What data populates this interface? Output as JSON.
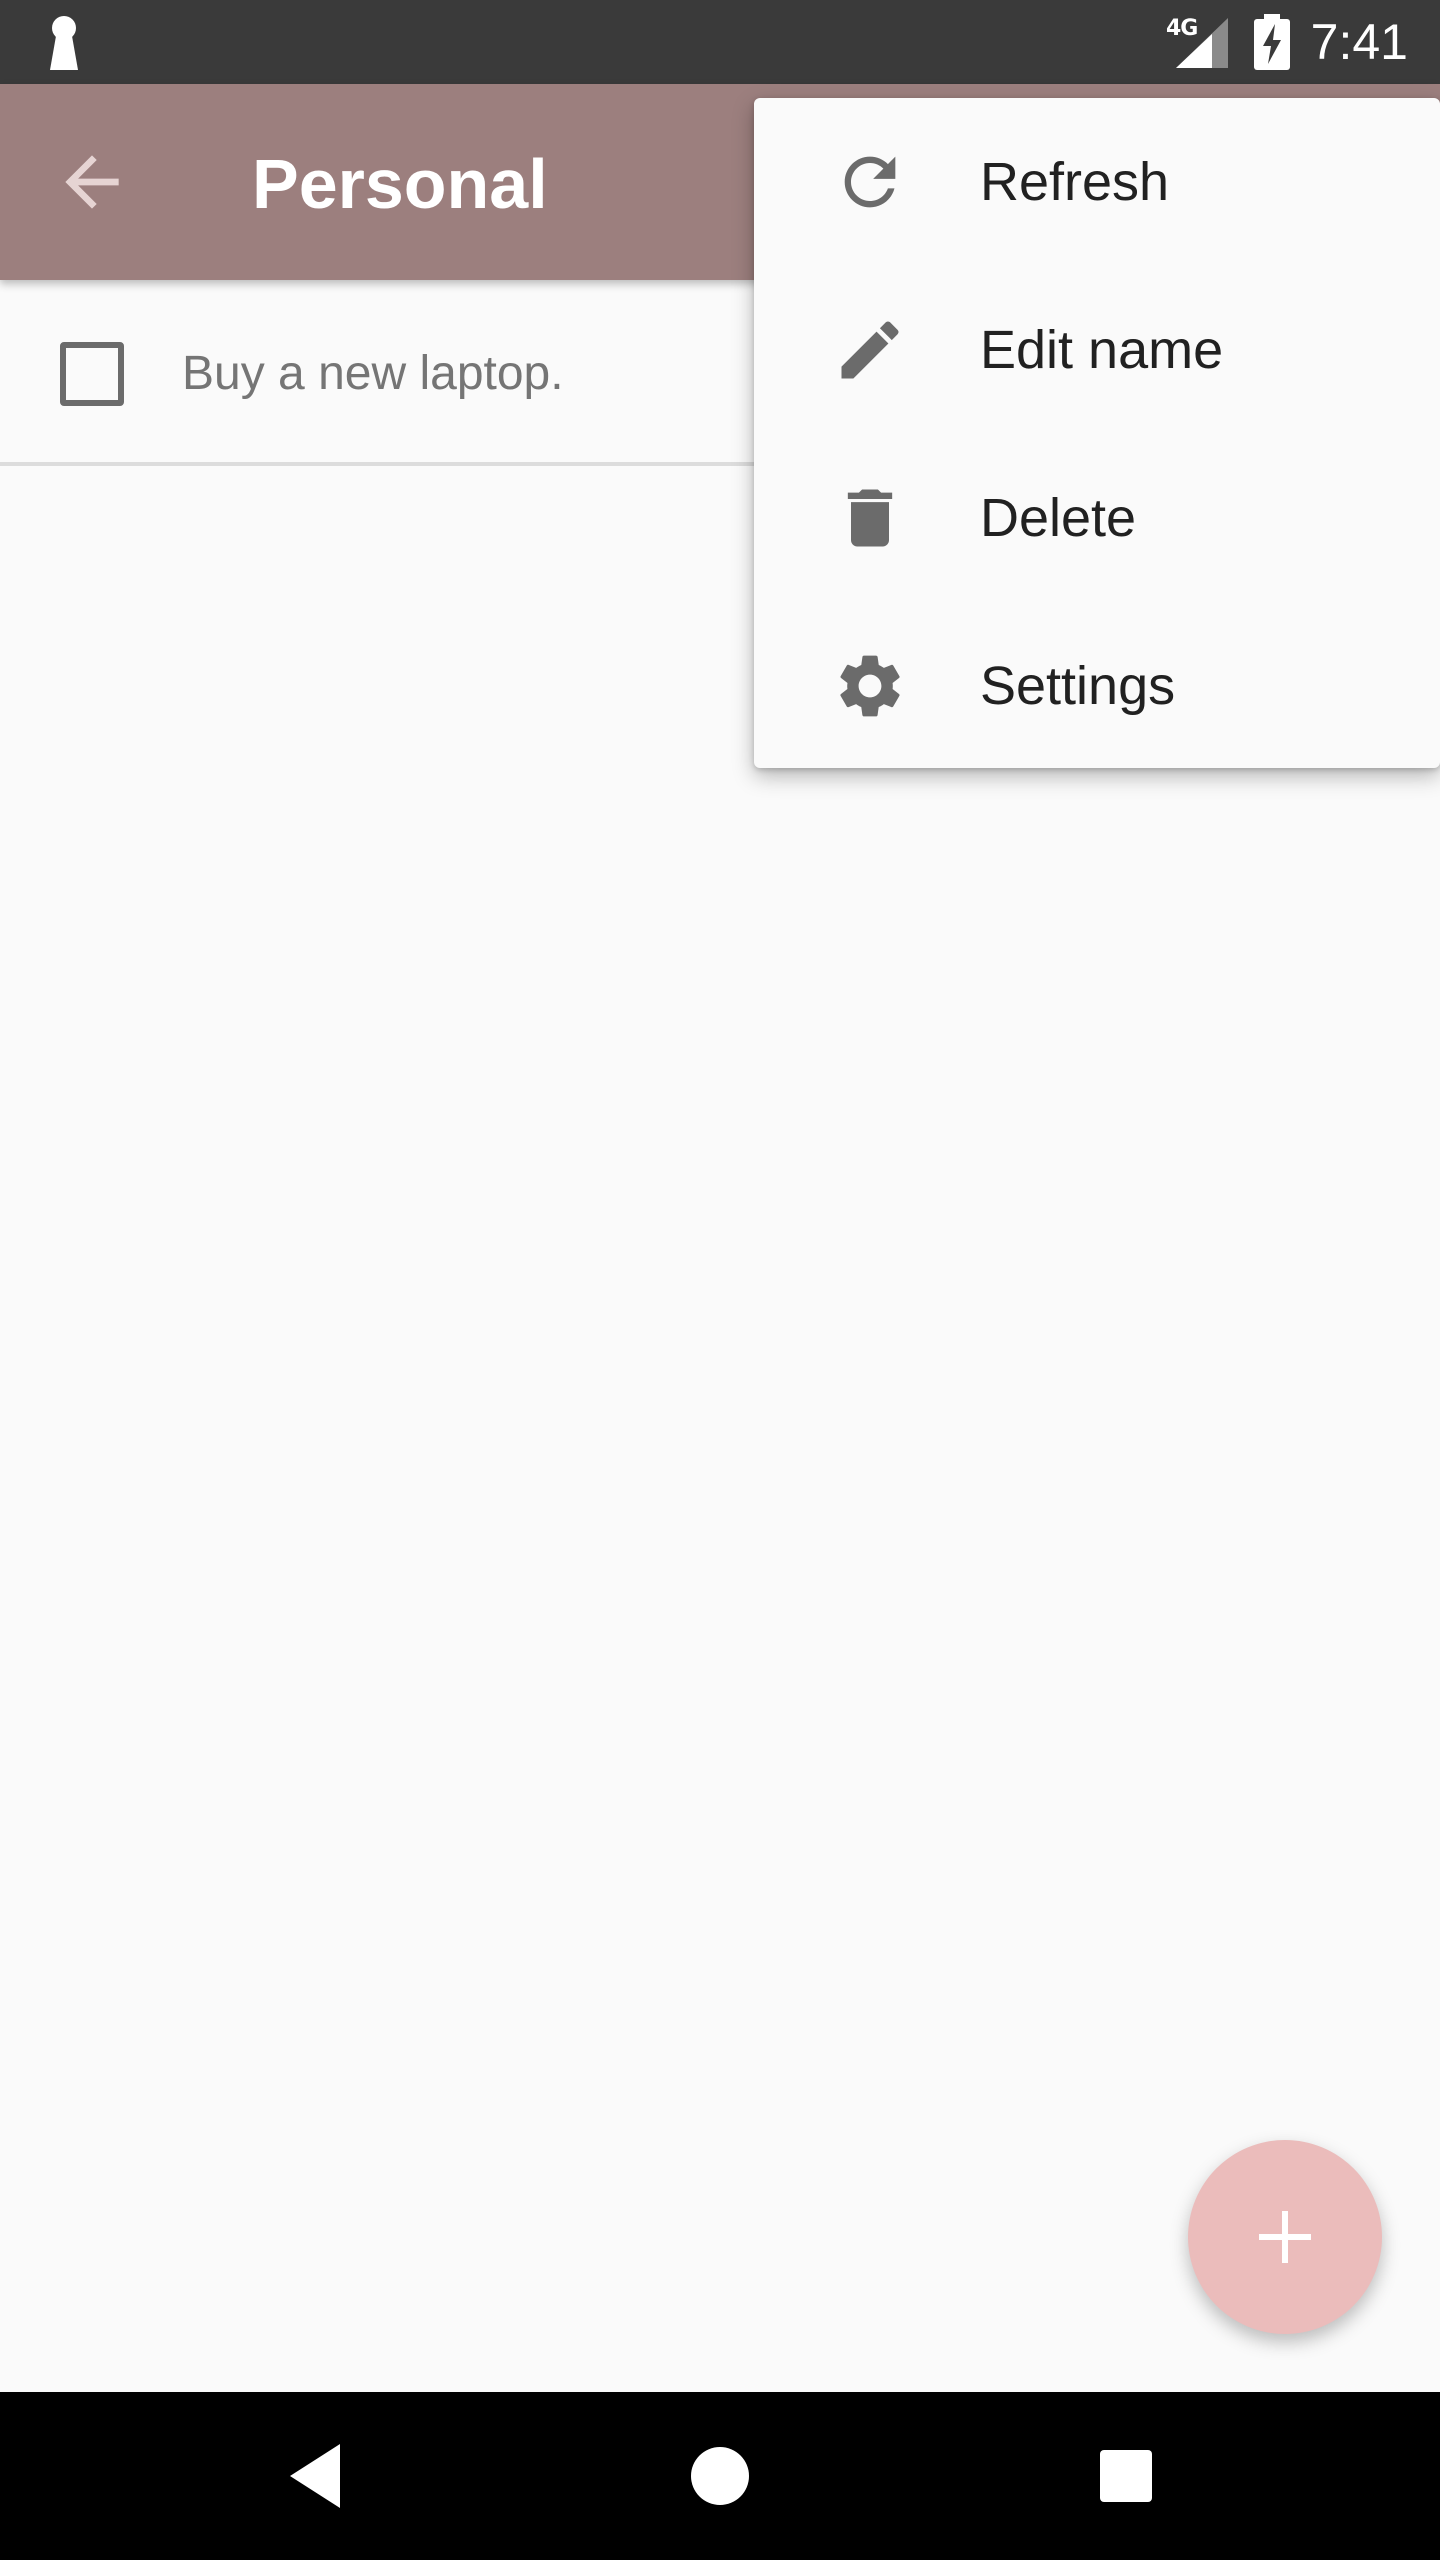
{
  "status_bar": {
    "network_label": "4G",
    "time": "7:41",
    "left_icon": "keyhole-icon",
    "signal_icon": "signal-icon",
    "battery_icon": "battery-charging-icon"
  },
  "app_bar": {
    "title": "Personal",
    "back_icon": "arrow-back-icon",
    "background_color": "#9c7f7e"
  },
  "tasks": [
    {
      "label": "Buy a new laptop.",
      "checked": false
    }
  ],
  "overflow_menu": {
    "items": [
      {
        "label": "Refresh",
        "icon": "refresh-icon"
      },
      {
        "label": "Edit name",
        "icon": "pencil-icon"
      },
      {
        "label": "Delete",
        "icon": "trash-icon"
      },
      {
        "label": "Settings",
        "icon": "gear-icon"
      }
    ]
  },
  "fab": {
    "icon": "plus-icon",
    "color": "#ebbcbb"
  },
  "nav_bar": {
    "back_icon": "nav-back-icon",
    "home_icon": "nav-home-icon",
    "recents_icon": "nav-recents-icon"
  }
}
